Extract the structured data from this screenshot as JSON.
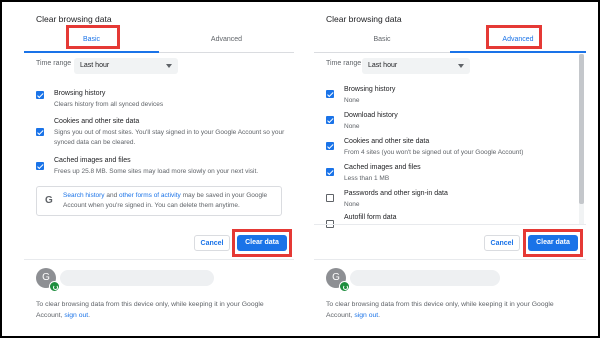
{
  "left": {
    "title": "Clear browsing data",
    "tabs": {
      "basic": "Basic",
      "advanced": "Advanced"
    },
    "time_range_label": "Time range",
    "time_range_value": "Last hour",
    "options": [
      {
        "title": "Browsing history",
        "subtitle": "Clears history from all synced devices",
        "checked": true
      },
      {
        "title": "Cookies and other site data",
        "subtitle": "Signs you out of most sites. You'll stay signed in to your Google Account so your synced data can be cleared.",
        "checked": true
      },
      {
        "title": "Cached images and files",
        "subtitle": "Frees up 25.8 MB. Some sites may load more slowly on your next visit.",
        "checked": true
      }
    ],
    "info": {
      "icon": "G",
      "link1": "Search history",
      "middle1": " and ",
      "link2": "other forms of activity",
      "rest": " may be saved in your Google Account when you're signed in. You can delete them anytime."
    },
    "cancel": "Cancel",
    "clear": "Clear data",
    "avatar_initial": "G",
    "bottom_text": "To clear browsing data from this device only, while keeping it in your Google Account, ",
    "bottom_link": "sign out",
    "bottom_end": "."
  },
  "right": {
    "title": "Clear browsing data",
    "tabs": {
      "basic": "Basic",
      "advanced": "Advanced"
    },
    "time_range_label": "Time range",
    "time_range_value": "Last hour",
    "options": [
      {
        "title": "Browsing history",
        "subtitle": "None",
        "checked": true
      },
      {
        "title": "Download history",
        "subtitle": "None",
        "checked": true
      },
      {
        "title": "Cookies and other site data",
        "subtitle": "From 4 sites (you won't be signed out of your Google Account)",
        "checked": true
      },
      {
        "title": "Cached images and files",
        "subtitle": "Less than 1 MB",
        "checked": true
      },
      {
        "title": "Passwords and other sign-in data",
        "subtitle": "None",
        "checked": false
      },
      {
        "title": "Autofill form data",
        "subtitle": "",
        "checked": false
      }
    ],
    "cancel": "Cancel",
    "clear": "Clear data",
    "avatar_initial": "G",
    "bottom_text": "To clear browsing data from this device only, while keeping it in your Google Account, ",
    "bottom_link": "sign out",
    "bottom_end": "."
  },
  "colors": {
    "accent": "#1a73e8",
    "highlight": "#e53935",
    "sync": "#1e8e3e"
  }
}
